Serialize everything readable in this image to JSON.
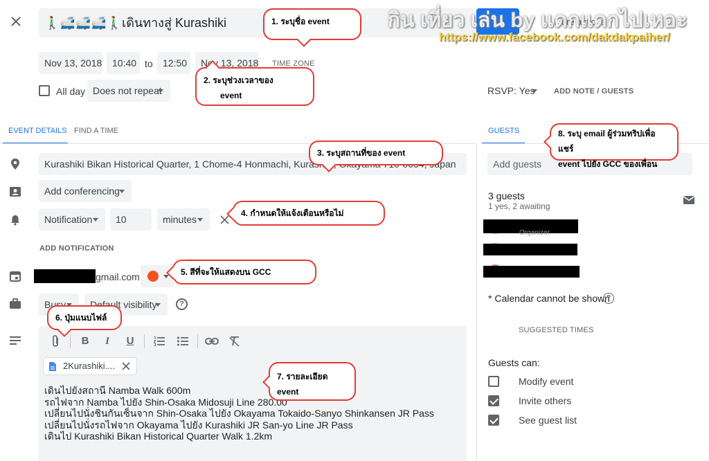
{
  "title": "🚶‍♂️🚅🚅🚅🚶‍♂️เดินทางสู่ Kurashiki",
  "watermark": {
    "text": "กิน เที่ยว เล่น by แดกแดกไปเหอะ",
    "url": "https://www.facebook.com/dakdakpaiher/"
  },
  "save_peek": "More actions",
  "dates": {
    "start_date": "Nov 13, 2018",
    "start_time": "10:40",
    "to": "to",
    "end_time": "12:50",
    "end_date": "Nov 13, 2018",
    "timezone": "TIME ZONE"
  },
  "all_day": "All day",
  "repeat": "Does not repeat",
  "rsvp": "RSVP: Yes",
  "add_note": "ADD NOTE / GUESTS",
  "tabs": {
    "details": "EVENT DETAILS",
    "find_time": "FIND A TIME",
    "guests": "GUESTS"
  },
  "location": "Kurashiki Bikan Historical Quarter, 1 Chome-4 Honmachi, Kurashiki, Okayama 710-0054, Japan",
  "conferencing": "Add conferencing",
  "notification": {
    "type": "Notification",
    "value": "10",
    "unit": "minutes"
  },
  "add_notification": "ADD NOTIFICATION",
  "calendar_email": "gmail.com",
  "calendar_color": "#f4511e",
  "busy": "Busy",
  "visibility": "Default visibility",
  "attachment": "2Kurashiki....",
  "description": [
    "เดินไปยังสถานี Namba Walk 600m",
    "รถไฟจาก Namba ไปยัง Shin-Osaka Midosuji Line 280.00",
    "เปลี่ยนไปนั่งชินกันเซ็นจาก Shin-Osaka ไปยัง Okayama Tokaido-Sanyo Shinkansen JR Pass",
    "เปลี่ยนไปนั่งรถไฟจาก Okayama ไปยัง Kurashiki JR San-yo Line JR Pass",
    "เดินไป Kurashiki Bikan Historical Quarter Walk 1.2km"
  ],
  "guests": {
    "placeholder": "Add guests",
    "count": "3 guests",
    "status": "1 yes, 2 awaiting",
    "organizer": "Organizer",
    "cannot_show": "* Calendar cannot be shown",
    "suggested": "SUGGESTED TIMES",
    "can_label": "Guests can:",
    "perms": [
      {
        "label": "Modify event",
        "checked": false
      },
      {
        "label": "Invite others",
        "checked": true
      },
      {
        "label": "See guest list",
        "checked": true
      }
    ]
  },
  "callouts": [
    "1. ระบุชื่อ event",
    "2. ระบุช่วงเวลาของ",
    "event",
    "3. ระบุสถานที่ของ event",
    "4. กำหนดให้แจ้งเตือนหรือไม่",
    "5. สีที่จะให้แสดงบน GCC",
    "6. ปุ่มแนบไฟล์",
    "7. รายละเอียด event",
    "8. ระบุ email ผู้ร่วมทริปเพื่อแชร์",
    "event ไปยัง GCC ของเพื่อน"
  ],
  "colors": {
    "accent": "#1a73e8",
    "callout_border": "#e53935",
    "field_bg": "#f1f3f4"
  }
}
